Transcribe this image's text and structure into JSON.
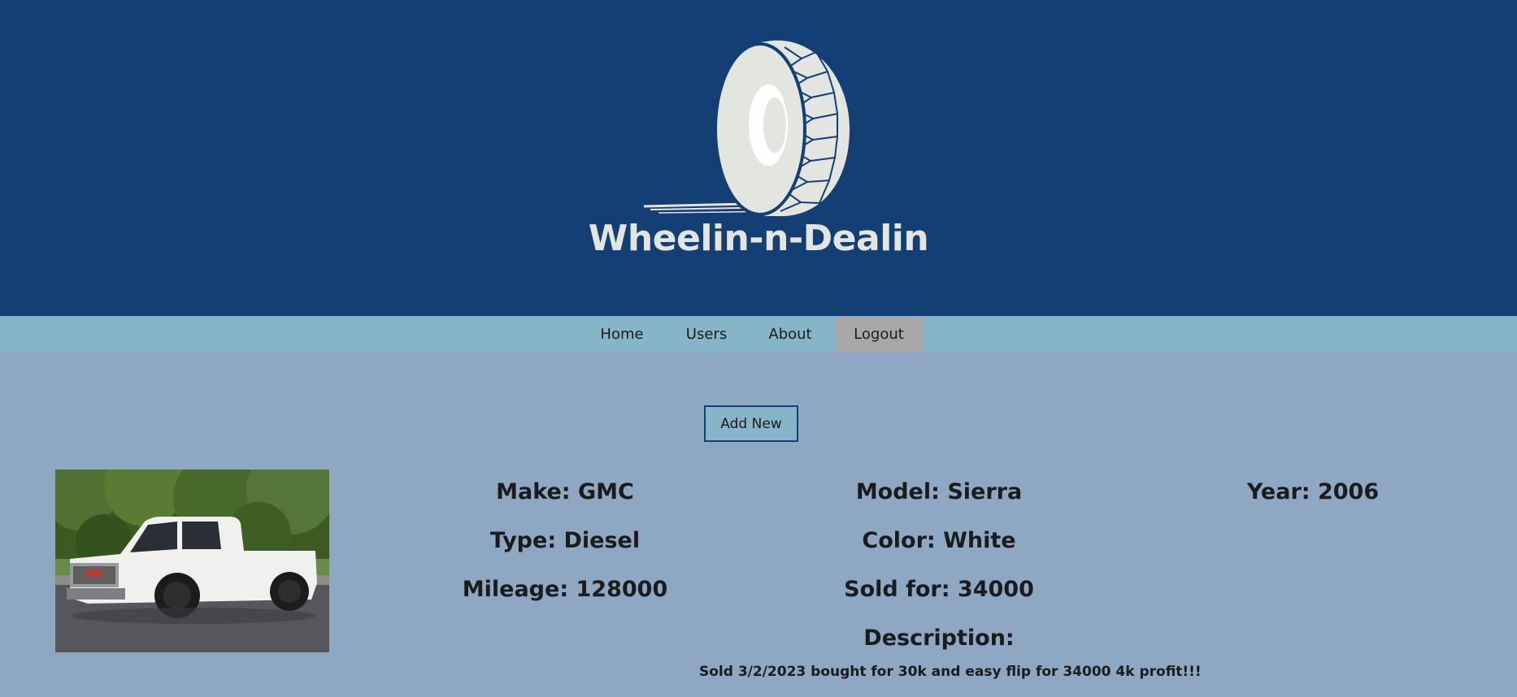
{
  "header": {
    "brand": "Wheelin-n-Dealin",
    "logo_icon": "tire-icon",
    "colors": {
      "header_bg": "#133f74",
      "nav_bg": "#86b4c8",
      "page_bg": "#8ea8c3",
      "active_nav": "#a8a8a8"
    }
  },
  "nav": {
    "home": "Home",
    "users": "Users",
    "about": "About",
    "logout": "Logout"
  },
  "actions": {
    "add_new": "Add New"
  },
  "listing": {
    "image_icon": "car-photo",
    "make": "Make: GMC",
    "model": "Model: Sierra",
    "year": "Year: 2006",
    "type": "Type: Diesel",
    "color": "Color: White",
    "mileage": "Mileage: 128000",
    "sold_for": "Sold for: 34000",
    "description_label": "Description:",
    "description": "Sold 3/2/2023 bought for 30k and easy flip for 34000 4k profit!!!"
  }
}
